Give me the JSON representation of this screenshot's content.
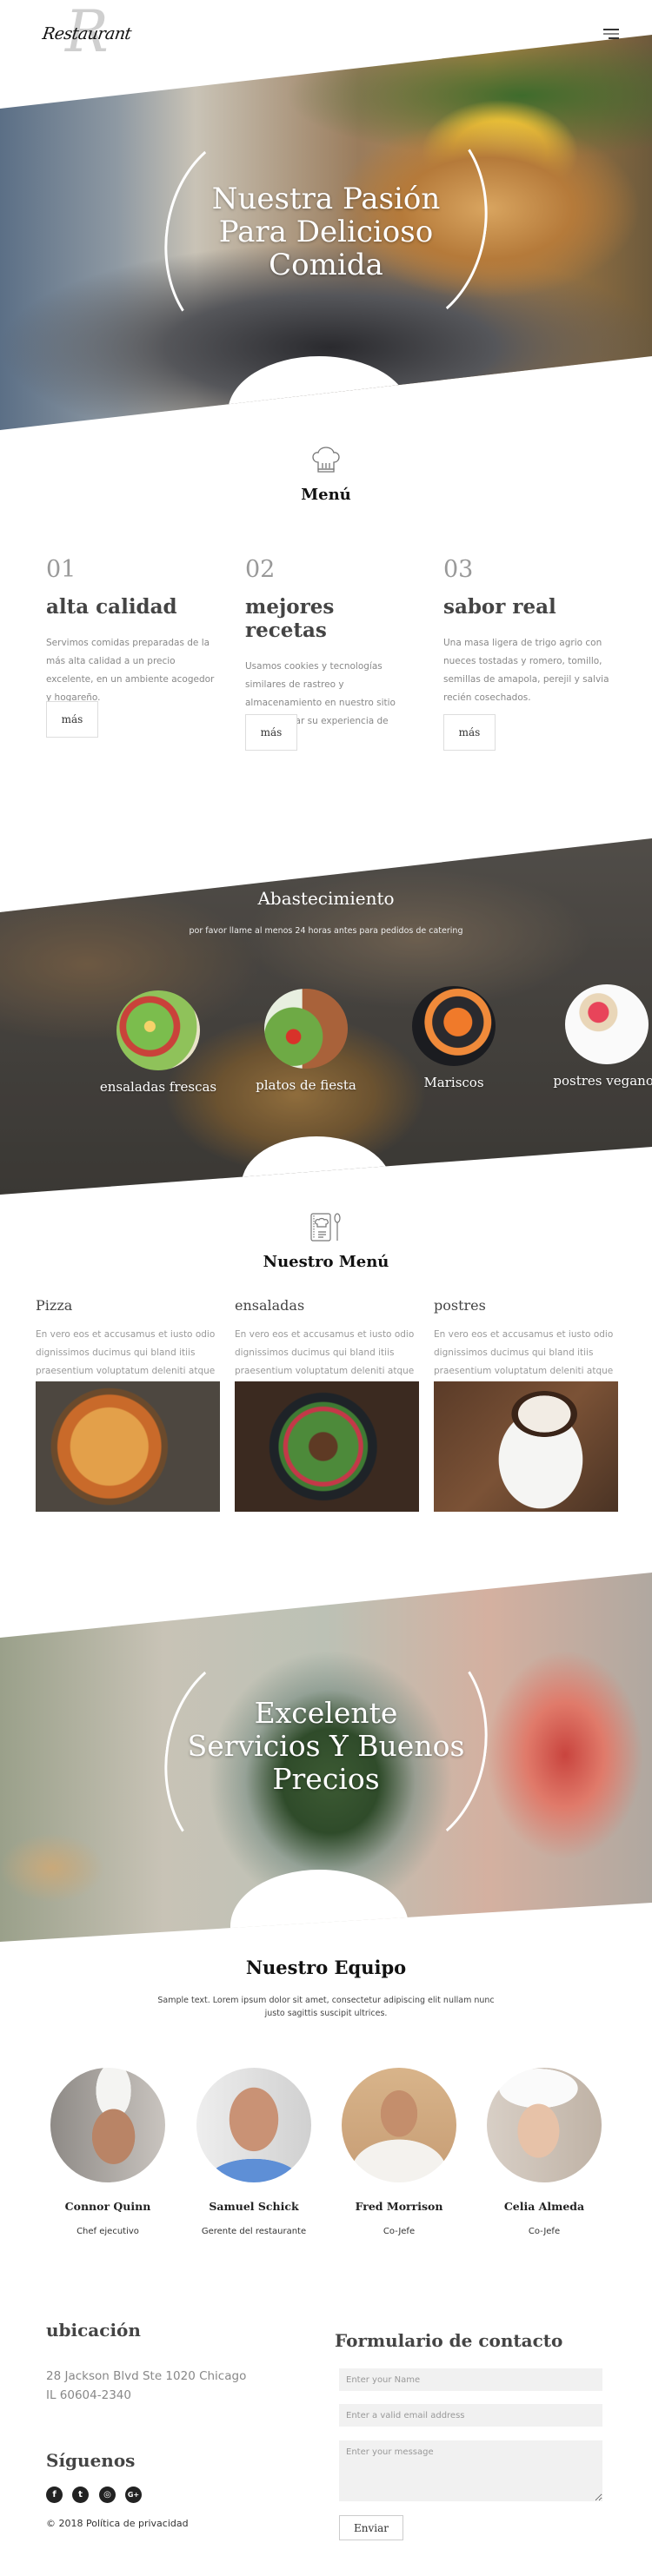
{
  "header": {
    "logo_text": "Restaurant",
    "logo_mark": "R",
    "menu_icon": "hamburger-icon"
  },
  "hero": {
    "title_lines": [
      "Nuestra Pasión",
      "Para Delicioso",
      "Comida"
    ]
  },
  "menu_section": {
    "icon": "chef-hat-icon",
    "title": "Menú",
    "features": [
      {
        "num": "01",
        "title": "alta calidad",
        "desc": "Servimos comidas preparadas de la más alta calidad a un precio excelente, en un ambiente acogedor y hogareño.",
        "button": "más"
      },
      {
        "num": "02",
        "title": "mejores recetas",
        "desc": "Usamos cookies y tecnologías similares de rastreo y almacenamiento en nuestro sitio para mejorar su experiencia de usuario.",
        "button": "más"
      },
      {
        "num": "03",
        "title": "sabor real",
        "desc": "Una masa ligera de trigo agrio con nueces tostadas y romero, tomillo, semillas de amapola, perejil y salvia recién cosechados.",
        "button": "más"
      }
    ]
  },
  "catering": {
    "title": "Abastecimiento",
    "subtitle": "por favor llame al menos 24 horas antes para pedidos de catering",
    "items": [
      {
        "label": "ensaladas frescas"
      },
      {
        "label": "platos de fiesta"
      },
      {
        "label": "Mariscos"
      },
      {
        "label": "postres veganos"
      }
    ]
  },
  "our_menu": {
    "icon": "menu-book-icon",
    "title": "Nuestro Menú",
    "dishes": [
      {
        "title": "Pizza",
        "desc": "En vero eos et accusamus et iusto odio dignissimos ducimus qui bland itiis praesentium voluptatum deleniti atque corrupti."
      },
      {
        "title": "ensaladas",
        "desc": "En vero eos et accusamus et iusto odio dignissimos ducimus qui bland itiis praesentium voluptatum deleniti atque corrupti."
      },
      {
        "title": "postres",
        "desc": "En vero eos et accusamus et iusto odio dignissimos ducimus qui bland itiis praesentium voluptatum deleniti atque corrupti."
      }
    ]
  },
  "banner": {
    "title_lines": [
      "Excelente",
      "Servicios Y Buenos",
      "Precios"
    ]
  },
  "team": {
    "title": "Nuestro Equipo",
    "subtitle": "Sample text. Lorem ipsum dolor sit amet, consectetur adipiscing elit nullam nunc justo sagittis suscipit ultrices.",
    "members": [
      {
        "name": "Connor Quinn",
        "role": "Chef ejecutivo"
      },
      {
        "name": "Samuel Schick",
        "role": "Gerente del restaurante"
      },
      {
        "name": "Fred Morrison",
        "role": "Co-Jefe"
      },
      {
        "name": "Celia Almeda",
        "role": "Co-Jefe"
      }
    ]
  },
  "footer": {
    "location_title": "ubicación",
    "address_line1": "28 Jackson Blvd Ste 1020 Chicago",
    "address_line2": "IL 60604-2340",
    "follow_title": "Síguenos",
    "social": [
      {
        "icon": "facebook-icon",
        "glyph": "f"
      },
      {
        "icon": "twitter-icon",
        "glyph": "t"
      },
      {
        "icon": "instagram-icon",
        "glyph": "◎"
      },
      {
        "icon": "google-plus-icon",
        "glyph": "G+"
      }
    ],
    "copyright": "© 2018 Política de privacidad",
    "contact_title": "Formulario de contacto",
    "name_placeholder": "Enter your Name",
    "email_placeholder": "Enter a valid email address",
    "message_placeholder": "Enter your message",
    "send_label": "Enviar"
  }
}
